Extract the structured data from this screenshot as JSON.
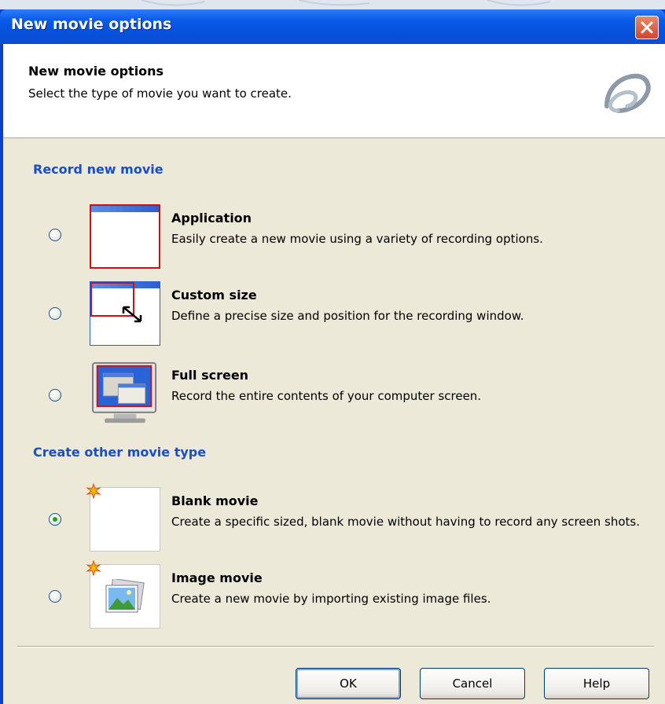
{
  "window": {
    "title": "New movie options",
    "close_icon": "close-icon"
  },
  "header": {
    "title": "New movie options",
    "subtitle": "Select the type of movie you want to create.",
    "logo_icon": "app-logo-icon"
  },
  "sections": {
    "record": "Record new movie",
    "other": "Create other movie type"
  },
  "options": {
    "application": {
      "title": "Application",
      "desc": "Easily create a new movie using a variety of recording options.",
      "selected": false,
      "icon": "application-window-icon"
    },
    "custom_size": {
      "title": "Custom size",
      "desc": "Define a precise size and position for the recording window.",
      "selected": false,
      "icon": "custom-size-icon"
    },
    "full_screen": {
      "title": "Full screen",
      "desc": "Record the entire contents of your computer screen.",
      "selected": false,
      "icon": "monitor-icon"
    },
    "blank_movie": {
      "title": "Blank movie",
      "desc": "Create a specific sized, blank movie without having to record any screen shots.",
      "selected": true,
      "icon": "blank-page-icon"
    },
    "image_movie": {
      "title": "Image movie",
      "desc": "Create a new movie by importing existing image files.",
      "selected": false,
      "icon": "image-icon"
    }
  },
  "buttons": {
    "ok": "OK",
    "cancel": "Cancel",
    "help": "Help"
  },
  "colors": {
    "titlebar": "#0a4dd0",
    "section_heading": "#1a4fc4",
    "dialog_face": "#ece9d8",
    "selection_red": "#d01010"
  }
}
